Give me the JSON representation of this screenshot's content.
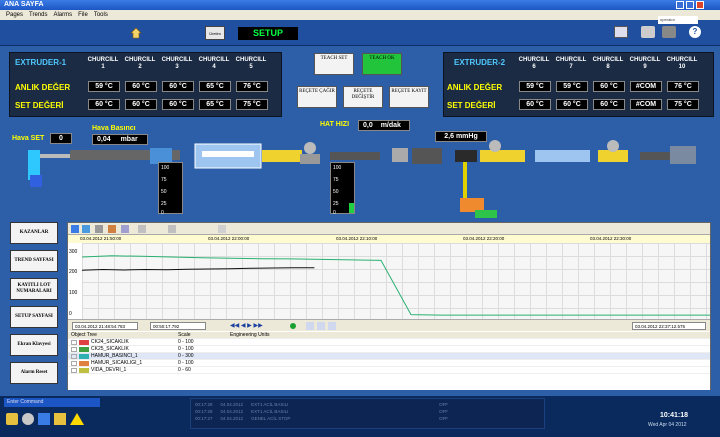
{
  "window": {
    "title": "ANA SAYFA"
  },
  "menu": [
    "Pages",
    "Trends",
    "Alarms",
    "File",
    "Tools"
  ],
  "toolbar": {
    "header_btn": "Üretim",
    "setup": "SETUP",
    "user_field": "operator"
  },
  "extruder1": {
    "title": "EXTRUDER-1",
    "cols": [
      "CHURCILL 1",
      "CHURCILL 2",
      "CHURCILL 3",
      "CHURCILL 4",
      "CHURCILL 5"
    ],
    "anlik_label": "ANLIK DEĞER",
    "set_label": "SET DEĞERİ",
    "anlik": [
      "59 °C",
      "60 °C",
      "60 °C",
      "65 °C",
      "76 °C"
    ],
    "set": [
      "60 °C",
      "60 °C",
      "60 °C",
      "65 °C",
      "75 °C"
    ]
  },
  "extruder2": {
    "title": "EXTRUDER-2",
    "cols": [
      "CHURCILL 6",
      "CHURCILL 7",
      "CHURCILL 8",
      "CHURCILL 9",
      "CHURCILL 10"
    ],
    "anlik_label": "ANLIK DEĞER",
    "set_label": "SET DEĞERİ",
    "anlik": [
      "59 °C",
      "59 °C",
      "60 °C",
      "#COM",
      "76 °C"
    ],
    "set": [
      "60 °C",
      "60 °C",
      "60 °C",
      "#COM",
      "75 °C"
    ]
  },
  "center_buttons": {
    "teach_set": "TEACH SET",
    "teach_ok": "TEACH OK",
    "recete_cagir": "REÇETE ÇAĞIR",
    "recete_degistir": "REÇETE DEĞİŞTİR",
    "recete_kayit": "REÇETE KAYIT"
  },
  "process": {
    "hava_set_label": "Hava SET",
    "hava_set_value": "0",
    "hava_basinci_label": "Hava Basıncı",
    "hava_basinci_value": "0,04",
    "hava_basinci_unit": "mbar",
    "hat_hizi_label": "HAT HIZI",
    "hat_hizi_value": "0,0",
    "hat_hizi_unit": "m/dak",
    "mmhg_value": "2,6 mmHg",
    "gauge_ticks": [
      "100",
      "75",
      "50",
      "25",
      "0"
    ]
  },
  "side_buttons": [
    "KAZANLAR",
    "TREND SAYFASI",
    "KAYITLI LOT NUMARALARI",
    "SETUP SAYFASI",
    "Ekran Klavyesi",
    "Alarm Reset"
  ],
  "trend": {
    "time_labels": [
      "03.04.2012 21:50:00",
      "03.04.2012 22:00:00",
      "03.04.2012 22:10:00",
      "03.04.2012 22:20:00",
      "03.04.2012 22:30:00"
    ],
    "y_ticks": [
      "300",
      "200",
      "100",
      "0"
    ],
    "start_time": "03.04.2012 21:48:54.783",
    "duration": "00:50:17.792",
    "end_time": "03.04.2012 22:37:12.575",
    "tree_headers": [
      "Object Tree",
      "Scale",
      "Engineering Units"
    ],
    "tree_rows": [
      {
        "name": "CK24_SICAKLIK",
        "scale": "0 - 100",
        "color": "#e04040"
      },
      {
        "name": "CK25_SICAKLIK",
        "scale": "0 - 100",
        "color": "#40a040"
      },
      {
        "name": "HAMUR_BASINCI_1",
        "scale": "0 - 300",
        "color": "#30b0b0"
      },
      {
        "name": "HAMUR_SICAKLIGI_1",
        "scale": "0 - 100",
        "color": "#e08040"
      },
      {
        "name": "VIDA_DEVRI_1",
        "scale": "0 - 60",
        "color": "#c0c040"
      }
    ],
    "series_green": [
      250,
      255,
      253,
      250,
      247,
      245,
      243,
      242,
      240,
      238,
      236,
      10,
      8,
      8,
      8,
      8,
      8,
      8,
      8,
      8,
      8,
      8
    ],
    "series_black": [
      195,
      198,
      196,
      198,
      197,
      199,
      200,
      201,
      203,
      204,
      205,
      205
    ]
  },
  "status": {
    "command_label": "Enter Command",
    "alarms": [
      {
        "time": "00:17:28",
        "date": "04.04.2012",
        "text": "EXT1 ACİL BASILI",
        "state": "OFF"
      },
      {
        "time": "00:17:28",
        "date": "04.04.2012",
        "text": "EXT1 ACİL BASILI",
        "state": "OFF"
      },
      {
        "time": "00:17:27",
        "date": "04.04.2012",
        "text": "GENEL ACİL STOP",
        "state": "OFF"
      }
    ],
    "clock": "10:41:18",
    "date": "Wed Apr 04 2012"
  }
}
